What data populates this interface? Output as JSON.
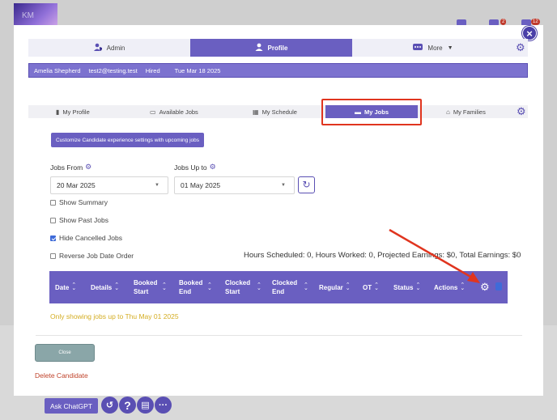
{
  "background": {
    "logo_text": "KM",
    "badges": [
      "2",
      "12"
    ]
  },
  "top_tabs": [
    {
      "label": "Admin",
      "icon": "user-shield-icon"
    },
    {
      "label": "Profile",
      "icon": "user-icon",
      "active": true
    },
    {
      "label": "More",
      "icon": "ellipsis-icon"
    }
  ],
  "info_bar": {
    "name": "Amelia Shepherd",
    "email": "test2@testing.test",
    "status": "Hired",
    "date": "Tue Mar 18 2025"
  },
  "sub_tabs": [
    {
      "label": "My Profile",
      "icon": "id-card-icon"
    },
    {
      "label": "Available Jobs",
      "icon": "briefcase-icon"
    },
    {
      "label": "My Schedule",
      "icon": "calendar-icon"
    },
    {
      "label": "My Jobs",
      "icon": "briefcase-icon",
      "active": true
    },
    {
      "label": "My Families",
      "icon": "home-icon"
    }
  ],
  "customize_button": "Customize Candidate experience settings with upcoming jobs",
  "jobs_from": {
    "label": "Jobs From",
    "value": "20 Mar 2025"
  },
  "jobs_up_to": {
    "label": "Jobs Up to",
    "value": "01 May 2025"
  },
  "checkboxes": [
    {
      "label": "Show Summary",
      "checked": false
    },
    {
      "label": "Show Past Jobs",
      "checked": false
    },
    {
      "label": "Hide Cancelled Jobs",
      "checked": true
    },
    {
      "label": "Reverse Job Date Order",
      "checked": false
    }
  ],
  "summary_text": "Hours Scheduled: 0, Hours Worked: 0, Projected Earnings: $0, Total Earnings: $0",
  "table_columns": [
    "Date",
    "Details",
    "Booked Start",
    "Booked End",
    "Clocked Start",
    "Clocked End",
    "Regular",
    "OT",
    "Status",
    "Actions"
  ],
  "only_showing_note": "Only showing jobs up to Thu May 01 2025",
  "close_button": "Close",
  "delete_link": "Delete Candidate",
  "bottom": {
    "chat_button": "Ask ChatGPT",
    "icons": [
      "history-icon",
      "help-icon",
      "document-icon",
      "ellipsis-icon"
    ]
  },
  "colors": {
    "primary": "#6a5fc1",
    "highlight_box": "#e0351f",
    "note": "#d4ad22",
    "danger": "#c0432b"
  }
}
